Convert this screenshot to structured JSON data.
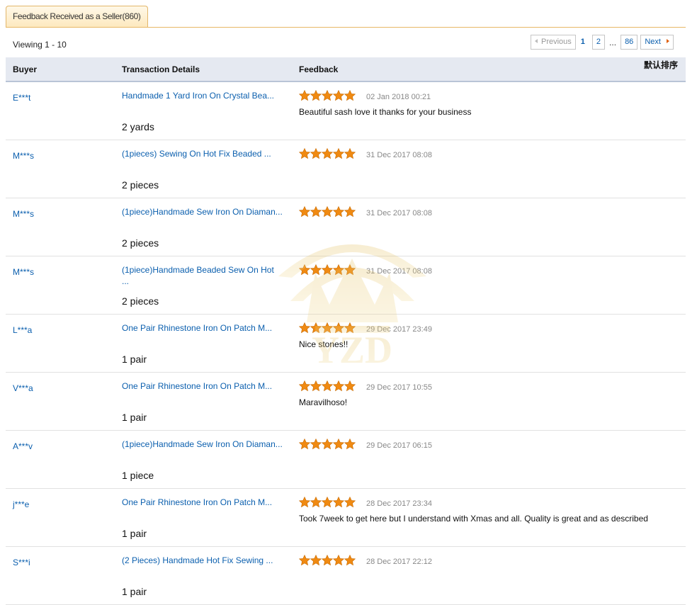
{
  "tab": {
    "label": "Feedback Received as a Seller(860)"
  },
  "viewing": "Viewing 1 - 10",
  "pager": {
    "previous": "Previous",
    "page1": "1",
    "page2": "2",
    "ellipsis": "...",
    "last": "86",
    "next": "Next"
  },
  "table": {
    "col_buyer": "Buyer",
    "col_details": "Transaction Details",
    "col_feedback": "Feedback",
    "sort_label": "默认排序"
  },
  "watermark": "YZD",
  "star_color": "#f08a12",
  "rows": [
    {
      "buyer": "E***t",
      "product": "Handmade 1 Yard Iron On Crystal Bea...",
      "qty": "2 yards",
      "stars": 5,
      "date": "02 Jan 2018 00:21",
      "comment": "Beautiful sash love it thanks for your business"
    },
    {
      "buyer": "M***s",
      "product": "(1pieces) Sewing On Hot Fix Beaded ...",
      "qty": "2 pieces",
      "stars": 5,
      "date": "31 Dec 2017 08:08",
      "comment": ""
    },
    {
      "buyer": "M***s",
      "product": "(1piece)Handmade Sew Iron On Diaman...",
      "qty": "2 pieces",
      "stars": 5,
      "date": "31 Dec 2017 08:08",
      "comment": ""
    },
    {
      "buyer": "M***s",
      "product": "(1piece)Handmade Beaded Sew On Hot ...",
      "qty": "2 pieces",
      "stars": 5,
      "date": "31 Dec 2017 08:08",
      "comment": ""
    },
    {
      "buyer": "L***a",
      "product": "One Pair Rhinestone Iron On Patch M...",
      "qty": "1 pair",
      "stars": 5,
      "date": "29 Dec 2017 23:49",
      "comment": "Nice stones!!"
    },
    {
      "buyer": "V***a",
      "product": "One Pair Rhinestone Iron On Patch M...",
      "qty": "1 pair",
      "stars": 5,
      "date": "29 Dec 2017 10:55",
      "comment": "Maravilhoso!"
    },
    {
      "buyer": "A***v",
      "product": "(1piece)Handmade Sew Iron On Diaman...",
      "qty": "1 piece",
      "stars": 5,
      "date": "29 Dec 2017 06:15",
      "comment": ""
    },
    {
      "buyer": "j***e",
      "product": "One Pair Rhinestone Iron On Patch M...",
      "qty": "1 pair",
      "stars": 5,
      "date": "28 Dec 2017 23:34",
      "comment": "Took 7week to get here but I understand with Xmas and all. Quality is great and as described"
    },
    {
      "buyer": "S***i",
      "product": "(2 Pieces) Handmade Hot Fix Sewing ...",
      "qty": "1 pair",
      "stars": 5,
      "date": "28 Dec 2017 22:12",
      "comment": ""
    }
  ]
}
